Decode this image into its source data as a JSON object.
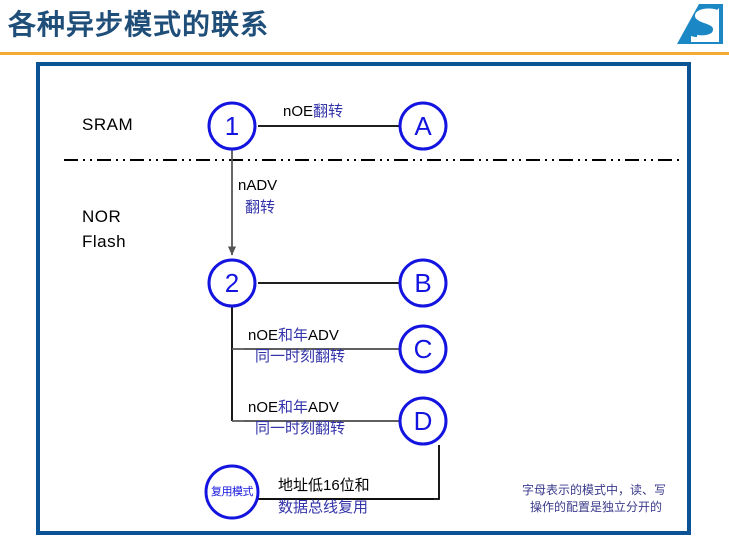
{
  "slide": {
    "title": "各种异步模式的联系",
    "logo_name": "st-logo",
    "accent_rule_color": "#F2AA33",
    "frame_color": "#0B5394",
    "title_color": "#1F4E79",
    "node_color": "#1414E0"
  },
  "regions": [
    {
      "id": "sram",
      "label": "SRAM"
    },
    {
      "id": "nor-flash",
      "label": "NOR\nFlash",
      "line1": "NOR",
      "line2": "Flash"
    }
  ],
  "nodes": [
    {
      "id": "node-1",
      "label": "1"
    },
    {
      "id": "node-2",
      "label": "2"
    },
    {
      "id": "node-a",
      "label": "A"
    },
    {
      "id": "node-b",
      "label": "B"
    },
    {
      "id": "node-c",
      "label": "C"
    },
    {
      "id": "node-d",
      "label": "D"
    },
    {
      "id": "node-mux",
      "label": "复用模式"
    }
  ],
  "edges": [
    {
      "id": "edge-1-a",
      "from": "1",
      "to": "A",
      "latin": "nOE",
      "cn": "翻转",
      "line2": ""
    },
    {
      "id": "edge-1-2",
      "from": "1",
      "to": "2",
      "latin": "nADV",
      "cn": "",
      "line2": "翻转"
    },
    {
      "id": "edge-2-b",
      "from": "2",
      "to": "B",
      "latin": "",
      "cn": "",
      "line2": ""
    },
    {
      "id": "edge-2-c",
      "from": "2",
      "to": "C",
      "latin": "nOE",
      "cn": "和年",
      "latin2": "ADV",
      "line2": "同一时刻翻转"
    },
    {
      "id": "edge-2-d",
      "from": "2",
      "to": "D",
      "latin": "nOE",
      "cn": "和年",
      "latin2": "ADV",
      "line2": "同一时刻翻转"
    },
    {
      "id": "edge-d-mux",
      "from": "D",
      "to": "复用模式",
      "line1": "地址低16位和",
      "line2": "数据总线复用"
    }
  ],
  "notes": [
    {
      "id": "note-letters",
      "line1": "字母表示的模式中，读、写",
      "line2": "操作的配置是独立分开的"
    }
  ]
}
